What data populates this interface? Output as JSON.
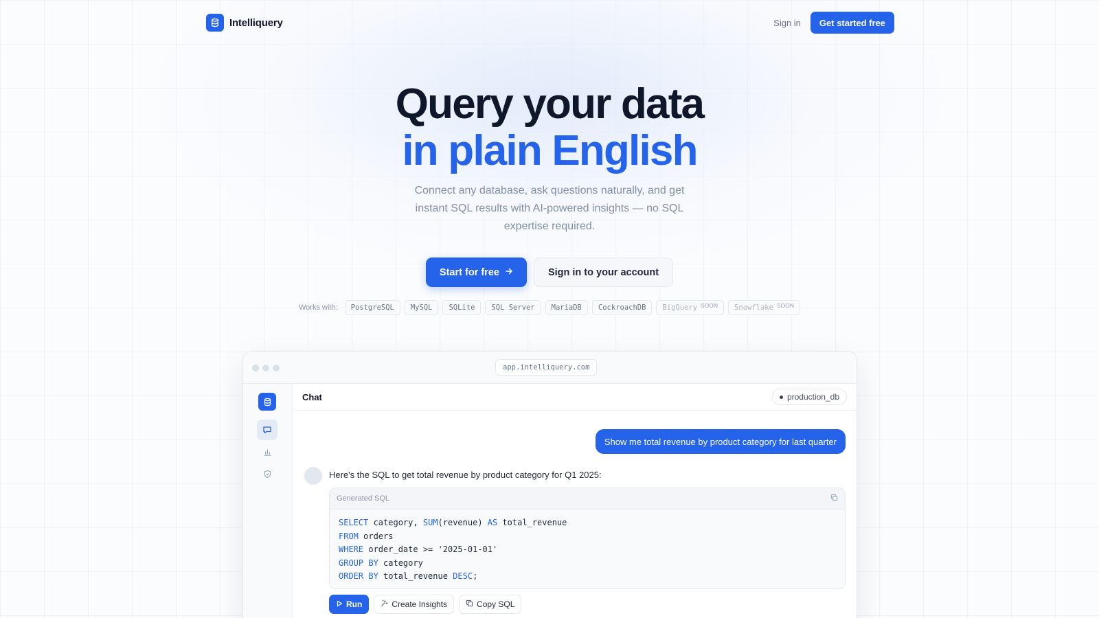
{
  "header": {
    "brand": "Intelliquery",
    "signin_label": "Sign in",
    "cta_label": "Get started free"
  },
  "hero": {
    "title_line1": "Query your data",
    "title_line2": "in plain English",
    "subtitle": "Connect any database, ask questions naturally, and get instant SQL results with AI-powered insights — no SQL expertise required.",
    "primary_cta": "Start for free",
    "secondary_cta": "Sign in to your account"
  },
  "works_with": {
    "label": "Works with:",
    "databases": [
      {
        "name": "PostgreSQL",
        "badge": ""
      },
      {
        "name": "MySQL",
        "badge": ""
      },
      {
        "name": "SQLite",
        "badge": ""
      },
      {
        "name": "SQL Server",
        "badge": ""
      },
      {
        "name": "MariaDB",
        "badge": ""
      },
      {
        "name": "CockroachDB",
        "badge": ""
      },
      {
        "name": "BigQuery",
        "badge": "SOON"
      },
      {
        "name": "Snowflake",
        "badge": "SOON"
      }
    ]
  },
  "app_window": {
    "url": "app.intelliquery.com",
    "chat_title": "Chat",
    "db_name": "production_db",
    "user_message": "Show me total revenue by product category for last quarter",
    "bot_message": "Here's the SQL to get total revenue by product category for Q1 2025:",
    "sql_label": "Generated SQL",
    "sql_lines": [
      [
        {
          "t": "SELECT",
          "k": true
        },
        {
          "t": " category, ",
          "k": false
        },
        {
          "t": "SUM",
          "k": true
        },
        {
          "t": "(revenue) ",
          "k": false
        },
        {
          "t": "AS",
          "k": true
        },
        {
          "t": " total_revenue",
          "k": false
        }
      ],
      [
        {
          "t": "FROM",
          "k": true
        },
        {
          "t": " orders",
          "k": false
        }
      ],
      [
        {
          "t": "WHERE",
          "k": true
        },
        {
          "t": " order_date >= '2025-01-01'",
          "k": false
        }
      ],
      [
        {
          "t": "GROUP BY",
          "k": true
        },
        {
          "t": " category",
          "k": false
        }
      ],
      [
        {
          "t": "ORDER BY",
          "k": true
        },
        {
          "t": " total_revenue ",
          "k": false
        },
        {
          "t": "DESC",
          "k": true
        },
        {
          "t": ";",
          "k": false
        }
      ]
    ],
    "actions": {
      "run": "Run",
      "insights": "Create Insights",
      "copy": "Copy SQL"
    }
  },
  "colors": {
    "accent": "#2563eb",
    "text": "#0f172a",
    "muted": "#8290a6"
  }
}
